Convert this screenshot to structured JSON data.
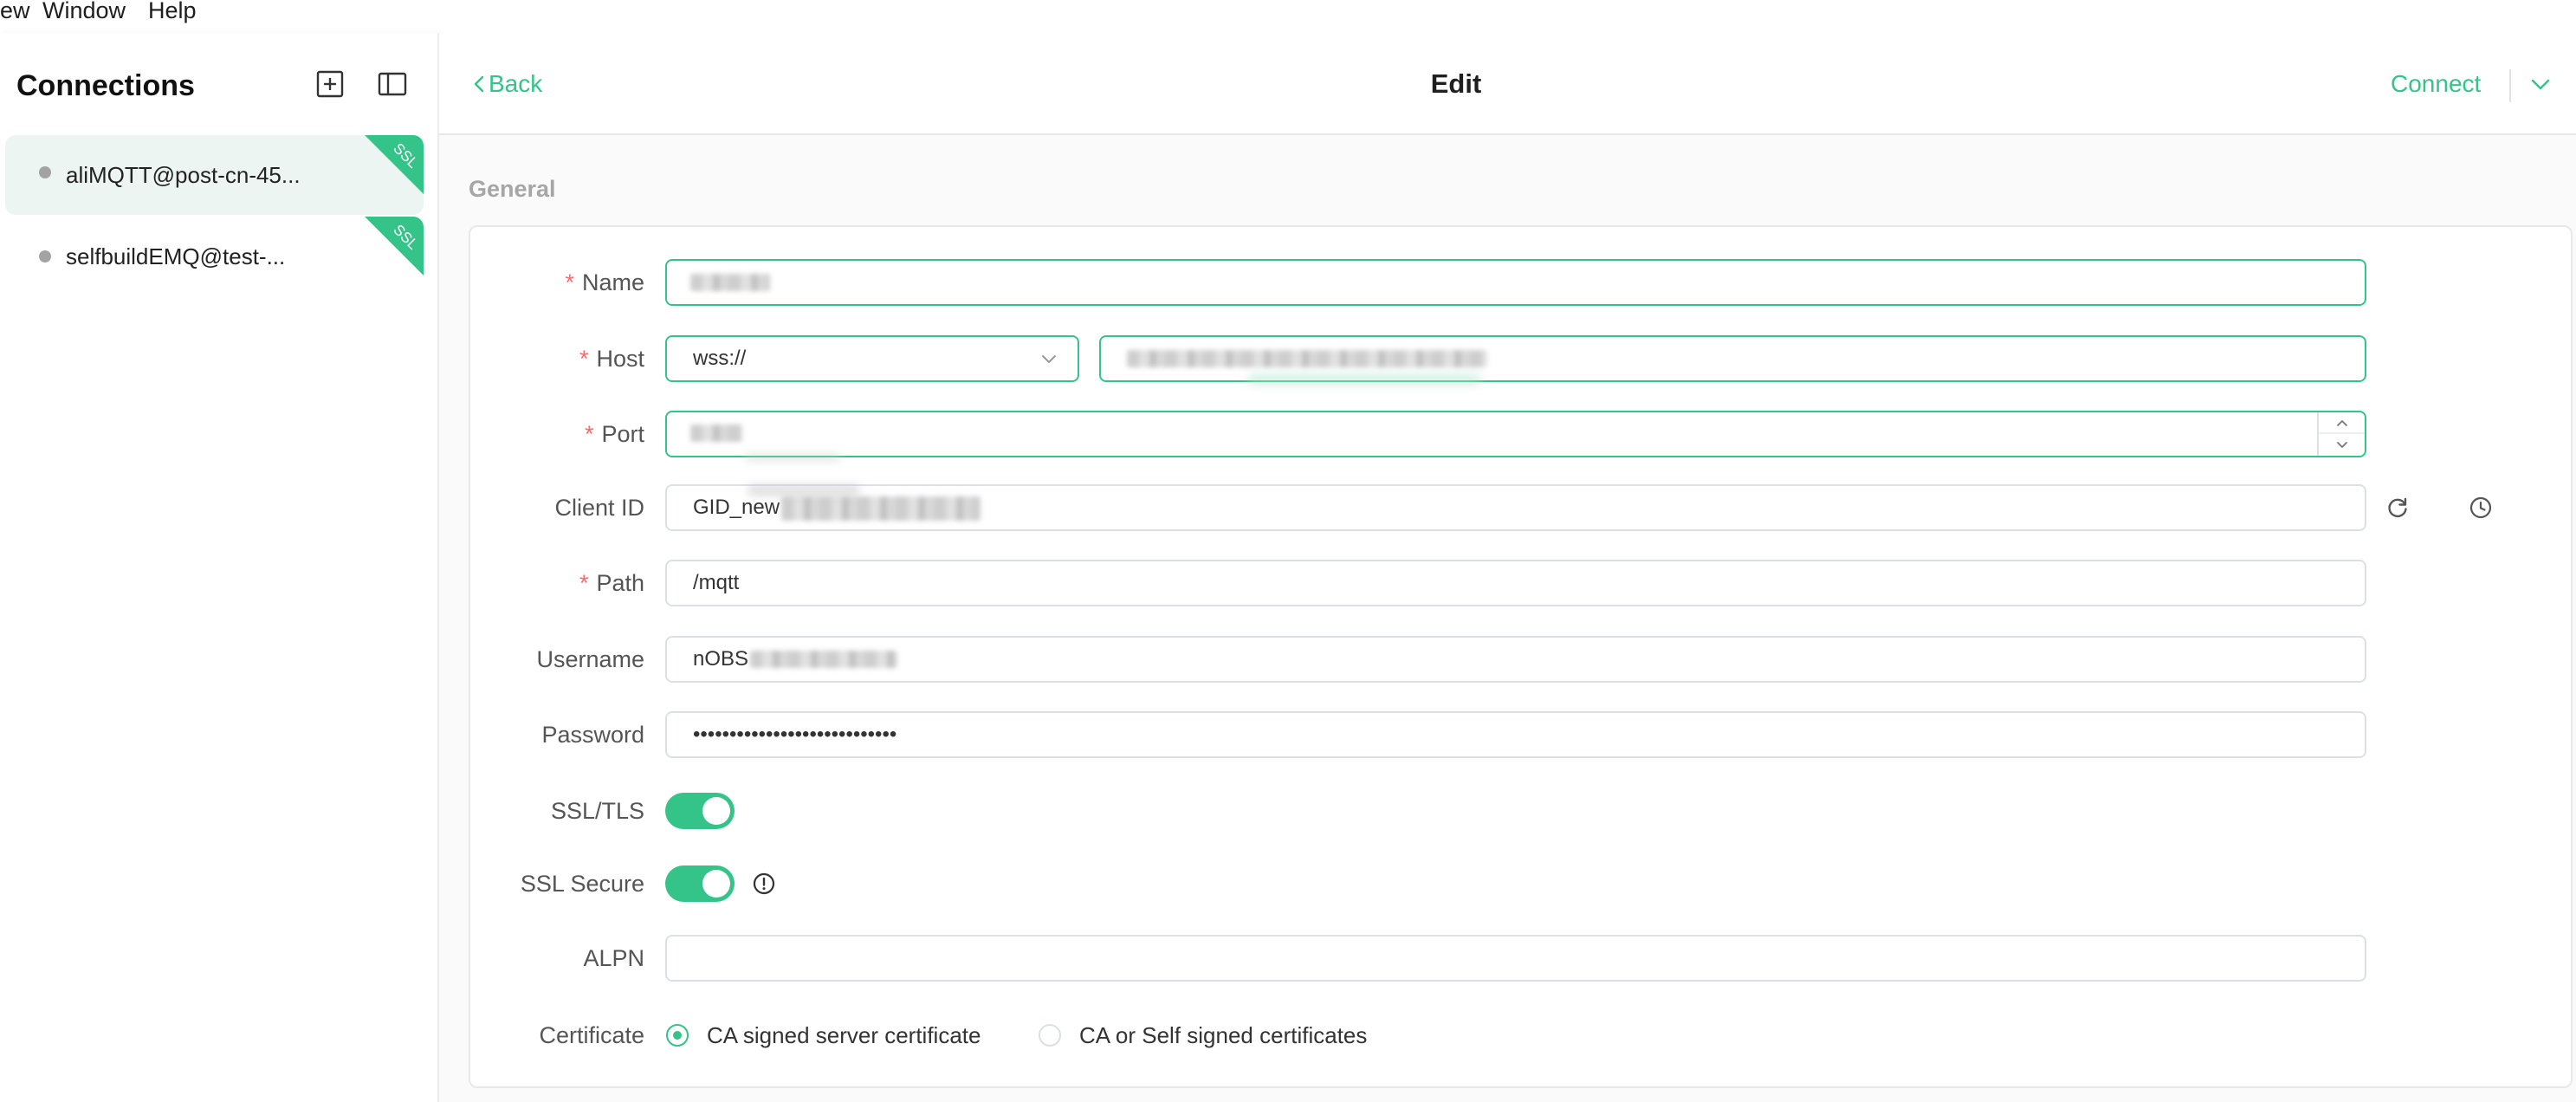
{
  "menu_bar": {
    "items": [
      "ew",
      "Window",
      "Help"
    ]
  },
  "sidebar": {
    "title": "Connections",
    "new_connection_icon": "plus-square-icon",
    "toggle_sidebar_icon": "sidebar-panel-icon",
    "connections": [
      {
        "name": "aliMQTT@post-cn-45...",
        "badge": "SSL",
        "selected": true
      },
      {
        "name": "selfbuildEMQ@test-...",
        "badge": "SSL",
        "selected": false
      }
    ]
  },
  "header": {
    "back_label": "Back",
    "title": "Edit",
    "connect_label": "Connect",
    "more_icon": "chevron-down-icon"
  },
  "form": {
    "section_title": "General",
    "required_mark": "*",
    "name": {
      "label": "Name",
      "required": true
    },
    "host": {
      "label": "Host",
      "required": true,
      "protocol": "wss://"
    },
    "port": {
      "label": "Port",
      "required": true
    },
    "client_id": {
      "label": "Client ID",
      "value": "GID_new",
      "icons": [
        "refresh-icon",
        "clock-icon"
      ]
    },
    "path": {
      "label": "Path",
      "required": true,
      "value": "/mqtt"
    },
    "username": {
      "label": "Username",
      "value": "nOBS"
    },
    "password": {
      "label": "Password",
      "value": "••••••••••••••••••••••••••••"
    },
    "ssl_tls": {
      "label": "SSL/TLS",
      "on": true
    },
    "ssl_secure": {
      "label": "SSL Secure",
      "on": true,
      "icon": "info-icon"
    },
    "alpn": {
      "label": "ALPN",
      "value": ""
    },
    "certificate": {
      "label": "Certificate",
      "options": [
        {
          "label": "CA signed server certificate",
          "selected": true
        },
        {
          "label": "CA or Self signed certificates",
          "selected": false
        }
      ]
    }
  },
  "colors": {
    "accent": "#34c388",
    "danger": "#f56c6c",
    "active_item_bg": "#edf5f2",
    "border": "#dcdfe6",
    "dot": "#a3a3a3"
  }
}
